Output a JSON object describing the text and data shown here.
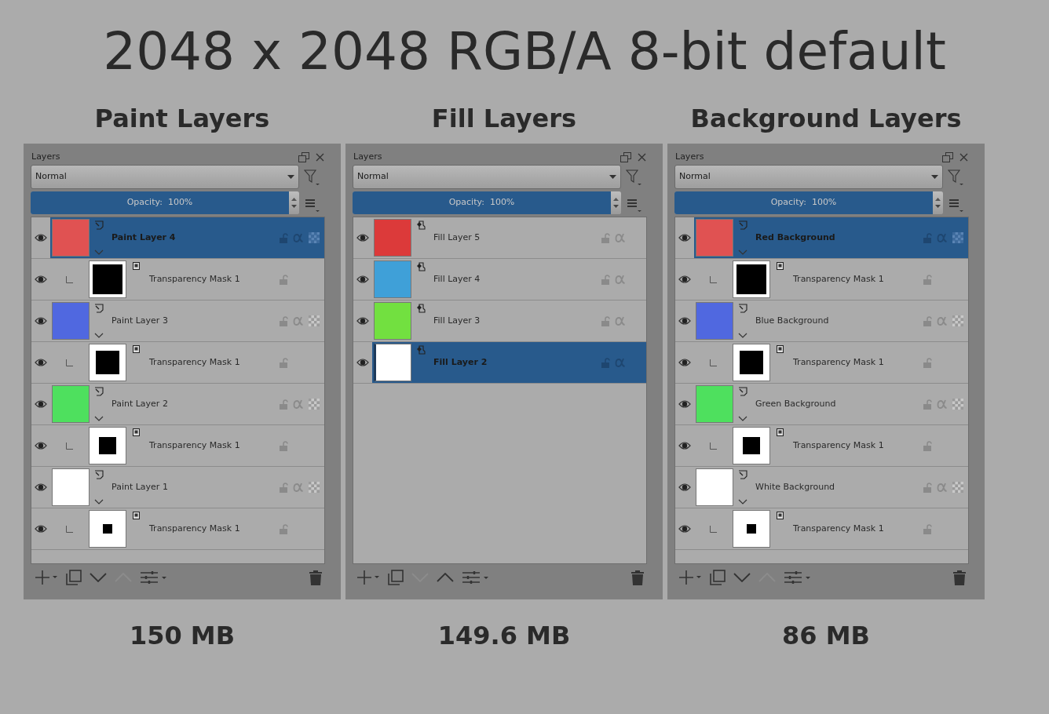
{
  "title": "2048 x 2048 RGB/A 8-bit default",
  "panels": [
    {
      "heading": "Paint Layers",
      "docker_title": "Layers",
      "blend_mode": "Normal",
      "opacity": {
        "label": "Opacity:  100%",
        "level": 1
      },
      "move_down_disabled": false,
      "move_up_disabled": true,
      "size": "150 MB",
      "layers": [
        {
          "kind": "paint",
          "name": "Paint Layer 4",
          "color": "#e05252",
          "selected": true
        },
        {
          "kind": "mask",
          "name": "Transparency Mask 1",
          "selected": false
        },
        {
          "kind": "paint",
          "name": "Paint Layer 3",
          "color": "#5068e0",
          "selected": false
        },
        {
          "kind": "mask",
          "name": "Transparency Mask 1",
          "selected": false
        },
        {
          "kind": "paint",
          "name": "Paint Layer 2",
          "color": "#4ee05e",
          "selected": false
        },
        {
          "kind": "mask",
          "name": "Transparency Mask 1",
          "selected": false
        },
        {
          "kind": "paint",
          "name": "Paint Layer 1",
          "color": "#ffffff",
          "selected": false
        },
        {
          "kind": "mask",
          "name": "Transparency Mask 1",
          "selected": false
        }
      ]
    },
    {
      "heading": "Fill Layers",
      "docker_title": "Layers",
      "blend_mode": "Normal",
      "opacity": {
        "label": "Opacity:  100%",
        "level": 1
      },
      "move_down_disabled": true,
      "move_up_disabled": false,
      "size": "149.6 MB",
      "layers": [
        {
          "kind": "fill",
          "name": "Fill Layer 5",
          "color": "#dc3a3a",
          "selected": false
        },
        {
          "kind": "fill",
          "name": "Fill Layer 4",
          "color": "#3fa0d8",
          "selected": false
        },
        {
          "kind": "fill",
          "name": "Fill Layer 3",
          "color": "#72e040",
          "selected": false
        },
        {
          "kind": "fill",
          "name": "Fill Layer 2",
          "color": "#ffffff",
          "selected": true
        }
      ]
    },
    {
      "heading": "Background Layers",
      "docker_title": "Layers",
      "blend_mode": "Normal",
      "opacity": {
        "label": "Opacity:  100%",
        "level": 1
      },
      "move_down_disabled": false,
      "move_up_disabled": true,
      "size": "86 MB",
      "layers": [
        {
          "kind": "paint",
          "name": "Red Background",
          "color": "#e05252",
          "selected": true
        },
        {
          "kind": "mask",
          "name": "Transparency Mask 1",
          "selected": false
        },
        {
          "kind": "paint",
          "name": "Blue Background",
          "color": "#5068e0",
          "selected": false
        },
        {
          "kind": "mask",
          "name": "Transparency Mask 1",
          "selected": false
        },
        {
          "kind": "paint",
          "name": "Green Background",
          "color": "#4ee05e",
          "selected": false
        },
        {
          "kind": "mask",
          "name": "Transparency Mask 1",
          "selected": false
        },
        {
          "kind": "paint",
          "name": "White Background",
          "color": "#ffffff",
          "selected": false
        },
        {
          "kind": "mask",
          "name": "Transparency Mask 1",
          "selected": false
        }
      ]
    }
  ]
}
